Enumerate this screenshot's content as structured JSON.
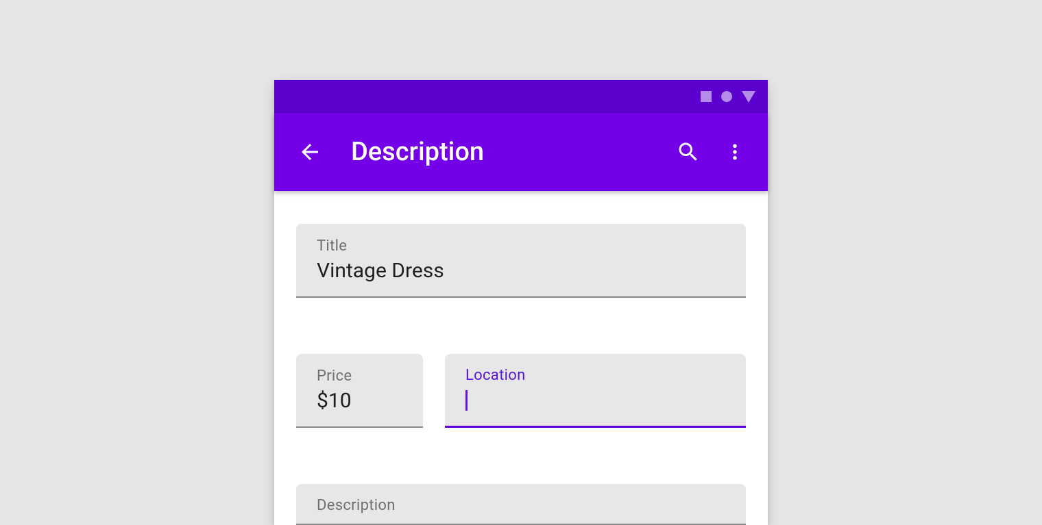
{
  "statusbar": {},
  "appbar": {
    "title": "Description"
  },
  "fields": {
    "title": {
      "label": "Title",
      "value": "Vintage Dress"
    },
    "price": {
      "label": "Price",
      "value": "$10"
    },
    "location": {
      "label": "Location",
      "value": ""
    },
    "description": {
      "label": "Description",
      "value": ""
    }
  },
  "colors": {
    "primary": "#7300e6",
    "primaryDark": "#5b00ce",
    "accent": "#6100d8"
  }
}
